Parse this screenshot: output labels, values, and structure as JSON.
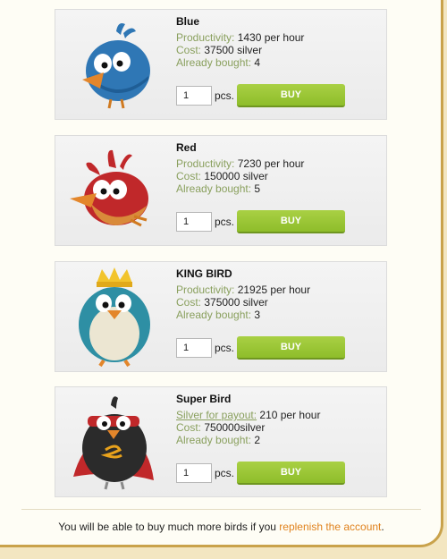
{
  "units_label": "pcs.",
  "buy_label": "BUY",
  "birds": [
    {
      "name": "Blue",
      "rate_label": "Productivity:",
      "rate_value": "1430 per hour",
      "cost_label": "Cost:",
      "cost_value": "37500 silver",
      "bought_label": "Already bought:",
      "bought_value": "4",
      "qty": "1",
      "color": "#2f77b5"
    },
    {
      "name": "Red",
      "rate_label": "Productivity:",
      "rate_value": "7230 per hour",
      "cost_label": "Cost:",
      "cost_value": "150000 silver",
      "bought_label": "Already bought:",
      "bought_value": "5",
      "qty": "1",
      "color": "#c0282a"
    },
    {
      "name": "KING BIRD",
      "rate_label": "Productivity:",
      "rate_value": "21925 per hour",
      "cost_label": "Cost:",
      "cost_value": "375000 silver",
      "bought_label": "Already bought:",
      "bought_value": "3",
      "qty": "1",
      "color": "#2e8fa4"
    },
    {
      "name": "Super Bird",
      "rate_label": "Silver for payout:",
      "rate_value": "210 per hour",
      "cost_label": "Cost:",
      "cost_value": "750000silver",
      "bought_label": "Already bought:",
      "bought_value": "2",
      "qty": "1",
      "color": "#2b2b2b"
    }
  ],
  "footer": {
    "text_before": "You will be able to buy much more birds if you ",
    "link": "replenish the account",
    "text_after": "."
  }
}
